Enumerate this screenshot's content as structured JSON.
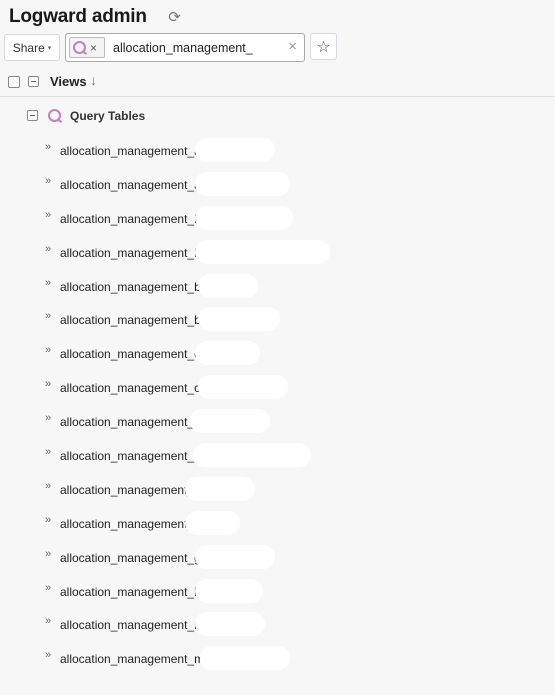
{
  "header": {
    "title": "Logward admin",
    "refresh_icon": "refresh-icon"
  },
  "toolbar": {
    "share_label": "Share",
    "share_caret": "▾",
    "filter_chip_icon": "query-icon",
    "filter_chip_remove": "×",
    "search_value": "allocation_management_",
    "clear_label": "×",
    "star_icon": "☆"
  },
  "views_header": {
    "label": "Views",
    "sort_icon": "↓"
  },
  "group": {
    "label": "Query Tables",
    "icon": "query-icon"
  },
  "items": [
    {
      "label": "allocation_management_a"
    },
    {
      "label": "allocation_management_a"
    },
    {
      "label": "allocation_management_B"
    },
    {
      "label": "allocation_management_B"
    },
    {
      "label": "allocation_management_bo"
    },
    {
      "label": "allocation_management_bo"
    },
    {
      "label": "allocation_management_c"
    },
    {
      "label": "allocation_management_co"
    },
    {
      "label": "allocation_management_e"
    },
    {
      "label": "allocation_management_e"
    },
    {
      "label": "allocation_management_"
    },
    {
      "label": "allocation_management_"
    },
    {
      "label": "allocation_management_g"
    },
    {
      "label": "allocation_management_l"
    },
    {
      "label": "allocation_management_m"
    },
    {
      "label": "allocation_management_m"
    }
  ],
  "chevron": "»"
}
